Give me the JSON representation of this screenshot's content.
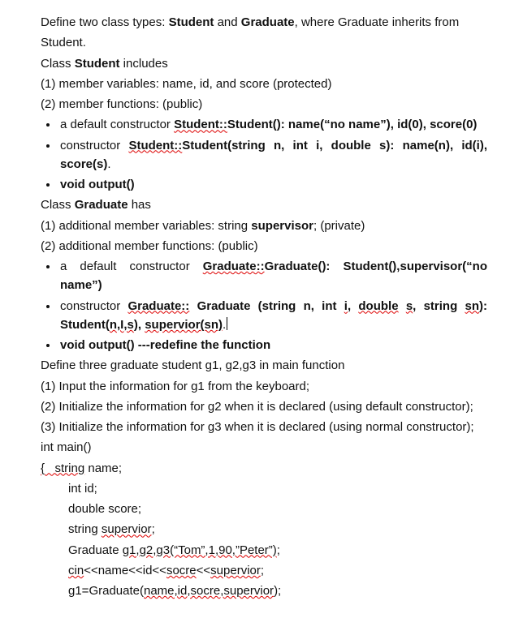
{
  "intro": {
    "l1a": "Define two class types: ",
    "l1b": "Student",
    "l1c": " and ",
    "l1d": "Graduate",
    "l1e": ", where Graduate inherits from",
    "l2": "Student."
  },
  "student": {
    "head_a": "Class ",
    "head_b": "Student",
    "head_c": " includes",
    "m1": "(1) member variables: name, id, and score (protected)",
    "m2": "(2) member functions: (public)",
    "b1": {
      "a": "a default constructor ",
      "sc": "Student::",
      "rest_bold": "Student(): name(“no name”), id(0), score(0)"
    },
    "b2": {
      "a": "constructor ",
      "sc": "Student::",
      "rest_bold": "Student(string n, int i, double s): name(n), id(i), score(s)",
      "dot": "."
    },
    "b3": "void output()"
  },
  "graduate": {
    "head_a": "Class ",
    "head_b": "Graduate",
    "head_c": " has",
    "m1a": "(1) additional member variables: string ",
    "m1b": "supervisor",
    "m1c": "; (private)",
    "m2": "(2) additional member functions: (public)",
    "b1": {
      "a": "a default constructor ",
      "gc": "Graduate::",
      "rest1": "Graduate(): Student(),supervisor(“no name”)"
    },
    "b2": {
      "a": "constructor ",
      "gc": "Graduate::",
      "sp": " ",
      "mid": "Graduate (string n, int ",
      "i": "i",
      "c1": ", ",
      "dbl": "double",
      "sp2": " ",
      "s": "s",
      "c2": ", string ",
      "sn": "sn",
      "close": "): ",
      "l2a": "Student(",
      "nls": "n,I,s",
      "l2b": "), ",
      "sv": "supervior(sn)",
      "dot": "."
    },
    "b3": "void output() ---redefine the function"
  },
  "main": {
    "d1": "Define three graduate student g1, g2,g3 in main function",
    "d2": "(1) Input the information for g1 from the keyboard;",
    "d3": "(2) Initialize the information for g2 when it is declared (using default constructor);",
    "d4": "(3) Initialize the information for g3 when it is declared (using normal constructor);",
    "c1": "int main()",
    "c2a": "{",
    "c2b": "   string",
    "c2c": " name;",
    "c3": "int id;",
    "c4": "double score;",
    "c5a": "string ",
    "c5b": "supervior",
    "c5c": ";",
    "c6a": "Graduate ",
    "c6b": "g1,g2,g3(“Tom”,1,90,”Peter”)",
    "c6c": ";",
    "c7a": "cin",
    "c7b": "<<name<<id<<",
    "c7c": "socre",
    "c7d": "<<",
    "c7e": "supervior",
    "c7f": ";",
    "c8a": "g1=Graduate(",
    "c8b": "name,id,socre,supervior",
    "c8c": ");"
  }
}
